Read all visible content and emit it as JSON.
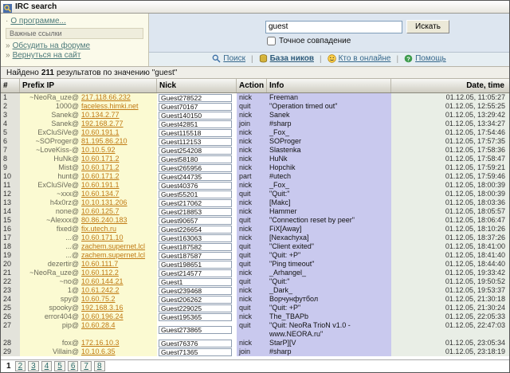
{
  "window": {
    "title": "IRC search"
  },
  "sidebar": {
    "about": "О программе...",
    "links_header": "Важные ссылки",
    "links": [
      {
        "label": "Обсудить на форуме"
      },
      {
        "label": "Вернуться на сайт"
      }
    ]
  },
  "search": {
    "value": "guest",
    "button": "Искать",
    "exact_label": "Точное совпадение"
  },
  "nav": {
    "items": [
      {
        "label": "Поиск",
        "icon": "search-icon"
      },
      {
        "label": "База ников",
        "icon": "database-icon"
      },
      {
        "label": "Кто в онлайне",
        "icon": "online-icon"
      },
      {
        "label": "Помощь",
        "icon": "help-icon"
      }
    ]
  },
  "results": {
    "prefix": "Найдено",
    "count": "211",
    "suffix": "результатов по значению \"guest\""
  },
  "table": {
    "headers": [
      "#",
      "Prefix IP",
      "Nick",
      "Action",
      "Info",
      "Date, time"
    ],
    "rows": [
      {
        "n": "1",
        "user": "~NeoRa_uze@",
        "host": "217.118.66.232",
        "nick": "Guest278522",
        "action": "nick",
        "info": "Freeman",
        "date": "01.12.05, 11:05:27"
      },
      {
        "n": "2",
        "user": "1000@",
        "host": "faceless.himki.net",
        "nick": "Guest70167",
        "action": "quit",
        "info": "\"Operation timed out\"",
        "date": "01.12.05, 12:55:25"
      },
      {
        "n": "3",
        "user": "Sanek@",
        "host": "10.134.2.77",
        "nick": "Guest140150",
        "action": "nick",
        "info": "Sanek",
        "date": "01.12.05, 13:29:42"
      },
      {
        "n": "4",
        "user": "Sanek@",
        "host": "192.168.2.77",
        "nick": "Guest42851",
        "action": "join",
        "info": "#sharp",
        "date": "01.12.05, 13:34:27"
      },
      {
        "n": "5",
        "user": "ExCluSiVe@",
        "host": "10.60.191.1",
        "nick": "Guest115518",
        "action": "nick",
        "info": "_Fox_",
        "date": "01.12.05, 17:54:46"
      },
      {
        "n": "6",
        "user": "~SOProger@",
        "host": "81.195.86.210",
        "nick": "Guest112153",
        "action": "nick",
        "info": "SOProger",
        "date": "01.12.05, 17:57:35"
      },
      {
        "n": "7",
        "user": "~LoveKiss-@",
        "host": "10.10.5.92",
        "nick": "Guest254208",
        "action": "nick",
        "info": "Slastenka",
        "date": "01.12.05, 17:58:36"
      },
      {
        "n": "8",
        "user": "HuNk@",
        "host": "10.60.171.2",
        "nick": "Guest58180",
        "action": "nick",
        "info": "HuNk",
        "date": "01.12.05, 17:58:47"
      },
      {
        "n": "9",
        "user": "Mist@",
        "host": "10.60.171.2",
        "nick": "Guest265956",
        "action": "nick",
        "info": "Hopchik",
        "date": "01.12.05, 17:59:21"
      },
      {
        "n": "10",
        "user": "hunt@",
        "host": "10.60.171.2",
        "nick": "Guest244735",
        "action": "part",
        "info": "#utech",
        "date": "01.12.05, 17:59:46"
      },
      {
        "n": "11",
        "user": "ExCluSiVe@",
        "host": "10.60.191.1",
        "nick": "Guest40376",
        "action": "nick",
        "info": "_Fox_",
        "date": "01.12.05, 18:00:39"
      },
      {
        "n": "12",
        "user": "~xxx@",
        "host": "10.60.134.7",
        "nick": "Guest55201",
        "action": "quit",
        "info": "\"Quit:\"",
        "date": "01.12.05, 18:00:39"
      },
      {
        "n": "13",
        "user": "h4x0rz@",
        "host": "10.10.131.206",
        "nick": "Guest217062",
        "action": "nick",
        "info": "[Makc]",
        "date": "01.12.05, 18:03:36"
      },
      {
        "n": "14",
        "user": "none@",
        "host": "10.60.125.7",
        "nick": "Guest218853",
        "action": "nick",
        "info": "Hammer",
        "date": "01.12.05, 18:05:57"
      },
      {
        "n": "15",
        "user": "~Alexxx@",
        "host": "80.86.240.183",
        "nick": "Guest90657",
        "action": "quit",
        "info": "\"Connection reset by peer\"",
        "date": "01.12.05, 18:06:47"
      },
      {
        "n": "16",
        "user": "fixed@",
        "host": "fix.utech.ru",
        "nick": "Guest226654",
        "action": "nick",
        "info": "FiX[Away]",
        "date": "01.12.05, 18:10:26"
      },
      {
        "n": "17",
        "user": "...@",
        "host": "10.60.171.10",
        "nick": "Guest163063",
        "action": "nick",
        "info": "[Nexachyxa]",
        "date": "01.12.05, 18:37:26"
      },
      {
        "n": "18",
        "user": "...@",
        "host": "zachem.supernet.lcl",
        "nick": "Guest187582",
        "action": "quit",
        "info": "\"Client exited\"",
        "date": "01.12.05, 18:41:00"
      },
      {
        "n": "19",
        "user": "...@",
        "host": "zachem.supernet.lcl",
        "nick": "Guest187587",
        "action": "quit",
        "info": "\"Quit: +P\"",
        "date": "01.12.05, 18:41:40"
      },
      {
        "n": "20",
        "user": "dezertir@",
        "host": "10.60.111.7",
        "nick": "Guest198651",
        "action": "quit",
        "info": "\"Ping timeout\"",
        "date": "01.12.05, 18:44:40"
      },
      {
        "n": "21",
        "user": "~NeoRa_uze@",
        "host": "10.60.112.2",
        "nick": "Guest214577",
        "action": "nick",
        "info": "_Arhangel_",
        "date": "01.12.05, 19:33:42"
      },
      {
        "n": "22",
        "user": "~no@",
        "host": "10.60.144.21",
        "nick": "Guest1",
        "action": "quit",
        "info": "\"Quit:\"",
        "date": "01.12.05, 19:50:52"
      },
      {
        "n": "23",
        "user": "1@",
        "host": "10.61.242.2",
        "nick": "Guest239468",
        "action": "nick",
        "info": "_Dark_",
        "date": "01.12.05, 19:53:37"
      },
      {
        "n": "24",
        "user": "spy@",
        "host": "10.60.75.2",
        "nick": "Guest206262",
        "action": "nick",
        "info": "Ворчунфутбол",
        "date": "01.12.05, 21:30:18"
      },
      {
        "n": "25",
        "user": "spooky@",
        "host": "192.168.3.16",
        "nick": "Guest229025",
        "action": "quit",
        "info": "\"Quit: +P\"",
        "date": "01.12.05, 21:30:24"
      },
      {
        "n": "26",
        "user": "error404@",
        "host": "10.60.196.24",
        "nick": "Guest195365",
        "action": "nick",
        "info": "The_TBAPb",
        "date": "01.12.05, 22:05:33"
      },
      {
        "n": "27",
        "user": "pip@",
        "host": "10.60.28.4",
        "nick": "Guest273865",
        "action": "quit",
        "info": "\"Quit: NeoRa TrioN v1.0 - www.NEORA.ru\"",
        "date": "01.12.05, 22:47:03"
      },
      {
        "n": "28",
        "user": "fox@",
        "host": "172.16.10.3",
        "nick": "Guest76376",
        "action": "nick",
        "info": "StarP][V",
        "date": "01.12.05, 23:05:34"
      },
      {
        "n": "29",
        "user": "Villain@",
        "host": "10.10.6.35",
        "nick": "Guest71365",
        "action": "join",
        "info": "#sharp",
        "date": "01.12.05, 23:18:19"
      }
    ]
  },
  "pagination": {
    "pages": [
      "1",
      "2",
      "3",
      "4",
      "5",
      "6",
      "7",
      "8"
    ],
    "current": "1"
  }
}
